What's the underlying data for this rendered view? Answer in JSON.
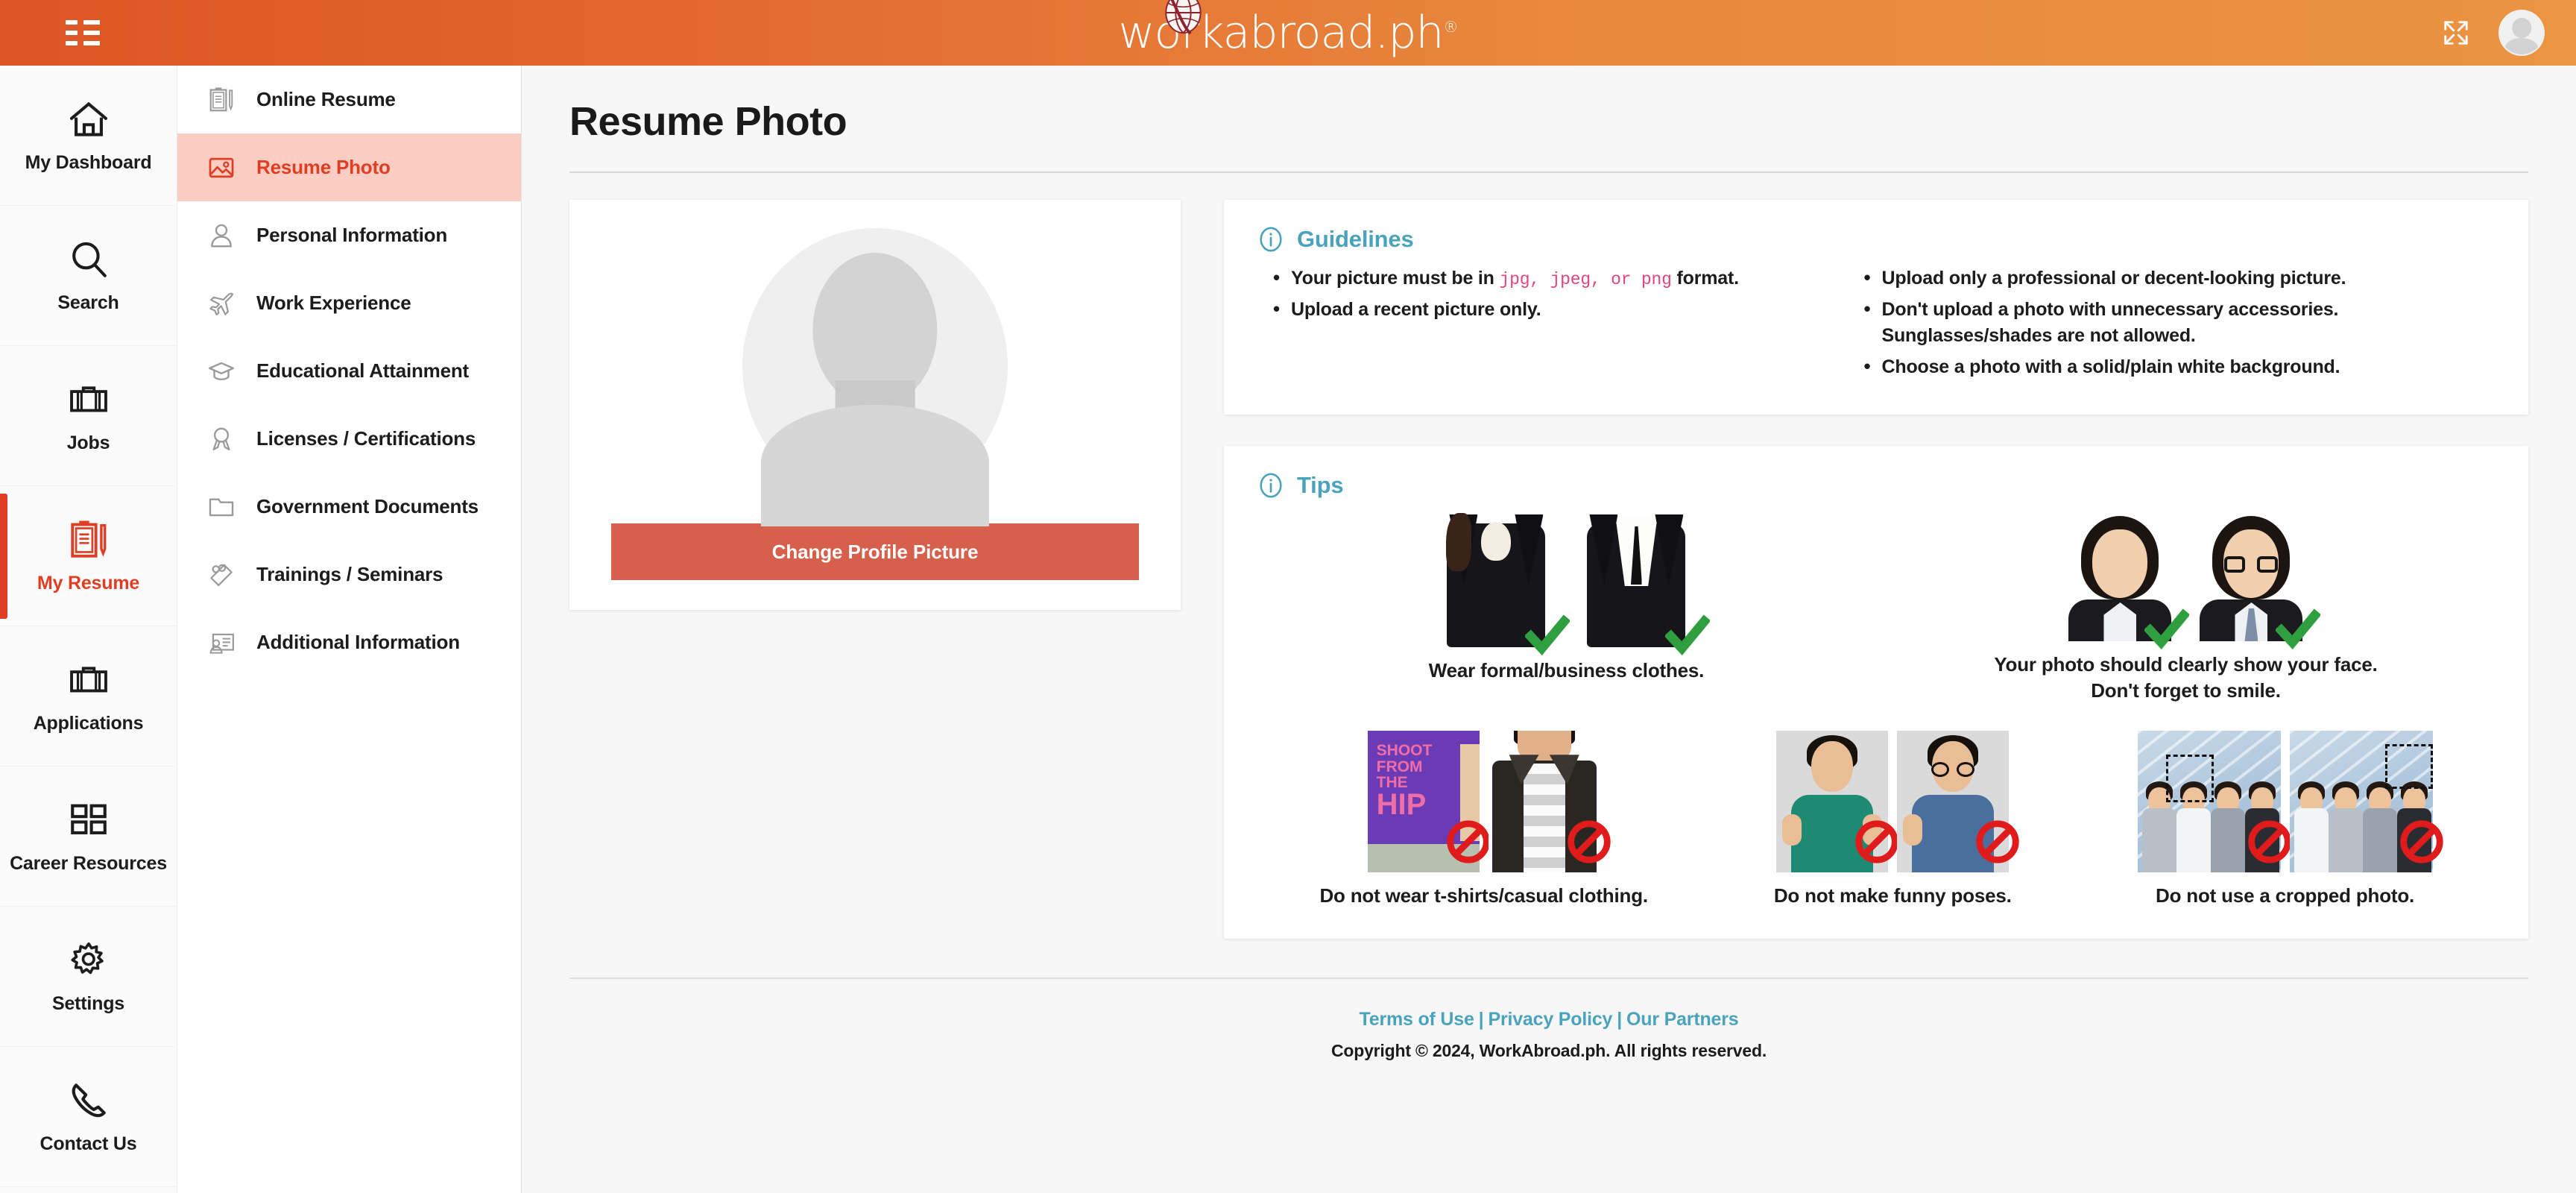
{
  "header": {
    "logo_text": "workabroad.ph",
    "logo_registered": "®",
    "menu_icon": "hamburger-icon",
    "expand_icon": "fullscreen-expand-icon",
    "avatar_icon": "user-avatar"
  },
  "rail": {
    "items": [
      {
        "label": "My Dashboard",
        "icon": "home-icon",
        "active": false
      },
      {
        "label": "Search",
        "icon": "search-icon",
        "active": false
      },
      {
        "label": "Jobs",
        "icon": "briefcase-icon",
        "active": false
      },
      {
        "label": "My Resume",
        "icon": "clipboard-pencil-icon",
        "active": true
      },
      {
        "label": "Applications",
        "icon": "briefcase-icon",
        "active": false
      },
      {
        "label": "Career Resources",
        "icon": "grid-icon",
        "active": false
      },
      {
        "label": "Settings",
        "icon": "gear-icon",
        "active": false
      },
      {
        "label": "Contact Us",
        "icon": "phone-icon",
        "active": false
      }
    ],
    "active_color": "#e03e24"
  },
  "subnav": {
    "items": [
      {
        "label": "Online Resume",
        "icon": "clipboard-pencil-icon",
        "active": false
      },
      {
        "label": "Resume Photo",
        "icon": "image-icon",
        "active": true
      },
      {
        "label": "Personal Information",
        "icon": "person-icon",
        "active": false
      },
      {
        "label": "Work Experience",
        "icon": "airplane-icon",
        "active": false
      },
      {
        "label": "Educational Attainment",
        "icon": "graduation-cap-icon",
        "active": false
      },
      {
        "label": "Licenses / Certifications",
        "icon": "award-ribbon-icon",
        "active": false
      },
      {
        "label": "Government Documents",
        "icon": "folder-icon",
        "active": false
      },
      {
        "label": "Trainings / Seminars",
        "icon": "puzzle-tag-icon",
        "active": false
      },
      {
        "label": "Additional Information",
        "icon": "id-card-icon",
        "active": false
      }
    ],
    "active_bg": "#fbcdc3",
    "active_color": "#e03e24"
  },
  "main": {
    "page_title": "Resume Photo",
    "photo_card": {
      "avatar_icon": "default-profile-placeholder",
      "change_button_label": "Change Profile Picture",
      "change_button_color": "#d6604b"
    },
    "guidelines": {
      "title": "Guidelines",
      "icon": "info-circle-icon",
      "title_color": "#4aa3bd",
      "left_items": [
        {
          "prefix": "Your picture must be in ",
          "code": "jpg, jpeg, or png",
          "suffix": " format."
        },
        {
          "prefix": "Upload a recent picture only.",
          "code": "",
          "suffix": ""
        }
      ],
      "right_items": [
        "Upload only a professional or decent-looking picture.",
        "Don't upload a photo with unnecessary accessories. Sunglasses/shades are not allowed.",
        "Choose a photo with a solid/plain white background."
      ],
      "code_color": "#e0457f"
    },
    "tips": {
      "title": "Tips",
      "icon": "info-circle-icon",
      "title_color": "#4aa3bd",
      "row1": [
        {
          "caption": "Wear formal/business clothes.",
          "mark": "check"
        },
        {
          "caption": "Your photo should clearly show your face. Don't forget to smile.",
          "mark": "check"
        }
      ],
      "row2": [
        {
          "caption": "Do not wear t-shirts/casual clothing.",
          "mark": "no-entry"
        },
        {
          "caption": "Do not make funny poses.",
          "mark": "no-entry"
        },
        {
          "caption": "Do not use a cropped photo.",
          "mark": "no-entry"
        }
      ],
      "tshirt_print": {
        "line1": "SHOOT",
        "line2": "FROM",
        "line3": "THE",
        "line4": "HIP"
      },
      "check_color": "#2e9e3e",
      "no_entry_color": "#e01b1b"
    }
  },
  "footer": {
    "terms": "Terms of Use",
    "privacy": "Privacy Policy",
    "partners": "Our Partners",
    "separator": "|",
    "copyright": "Copyright © 2024, WorkAbroad.ph. All rights reserved.",
    "link_color": "#4aa3bd"
  }
}
